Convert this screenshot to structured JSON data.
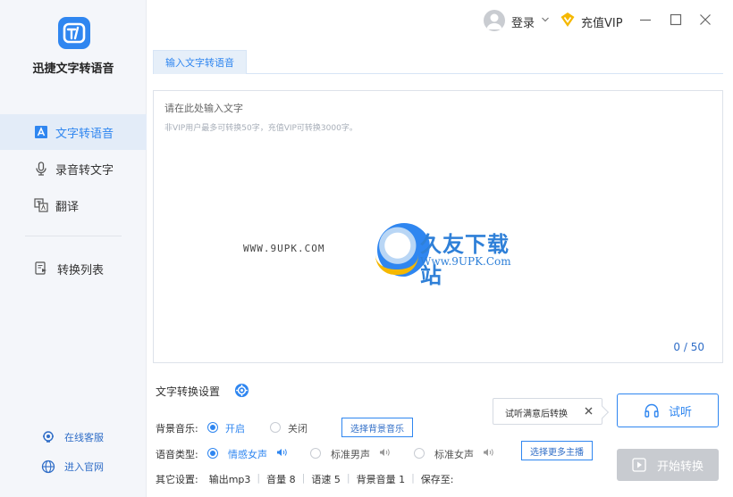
{
  "app": {
    "name": "迅捷文字转语音"
  },
  "colors": {
    "accent": "#2f86f0",
    "sidebar_bg": "#f4f6fa",
    "disabled": "#c8cbd0",
    "vip": "#f5b800"
  },
  "sidebar": {
    "items": [
      {
        "label": "文字转语音",
        "icon": "text-to-speech-icon",
        "active": true
      },
      {
        "label": "录音转文字",
        "icon": "microphone-icon",
        "active": false
      },
      {
        "label": "翻译",
        "icon": "translate-icon",
        "active": false
      }
    ],
    "list_item": {
      "label": "转换列表",
      "icon": "list-icon"
    },
    "links": [
      {
        "label": "在线客服",
        "icon": "support-icon"
      },
      {
        "label": "进入官网",
        "icon": "globe-icon"
      }
    ]
  },
  "topbar": {
    "login": "登录",
    "vip": "充值VIP"
  },
  "tabs": [
    {
      "label": "输入文字转语音"
    }
  ],
  "editor": {
    "placeholder": "请在此处输入文字",
    "hint": "非VIP用户最多可转换50字，充值VIP可转换3000字。",
    "counter": "0 / 50"
  },
  "watermark": {
    "left": "WWW.9UPK.COM",
    "title": "久友下载站",
    "url": "Www.9UPK.Com"
  },
  "settings": {
    "title": "文字转换设置",
    "bg_music": {
      "label": "背景音乐:",
      "on": "开启",
      "off": "关闭",
      "button": "选择背景音乐"
    },
    "voice": {
      "label": "语音类型:",
      "options": [
        "情感女声",
        "标准男声",
        "标准女声"
      ],
      "button": "选择更多主播"
    },
    "other": {
      "label": "其它设置:",
      "items": [
        "输出mp3",
        "音量 8",
        "语速 5",
        "背景音量 1",
        "保存至:"
      ]
    }
  },
  "tooltip": {
    "text": "试听满意后转换"
  },
  "actions": {
    "listen": "试听",
    "start": "开始转换"
  }
}
